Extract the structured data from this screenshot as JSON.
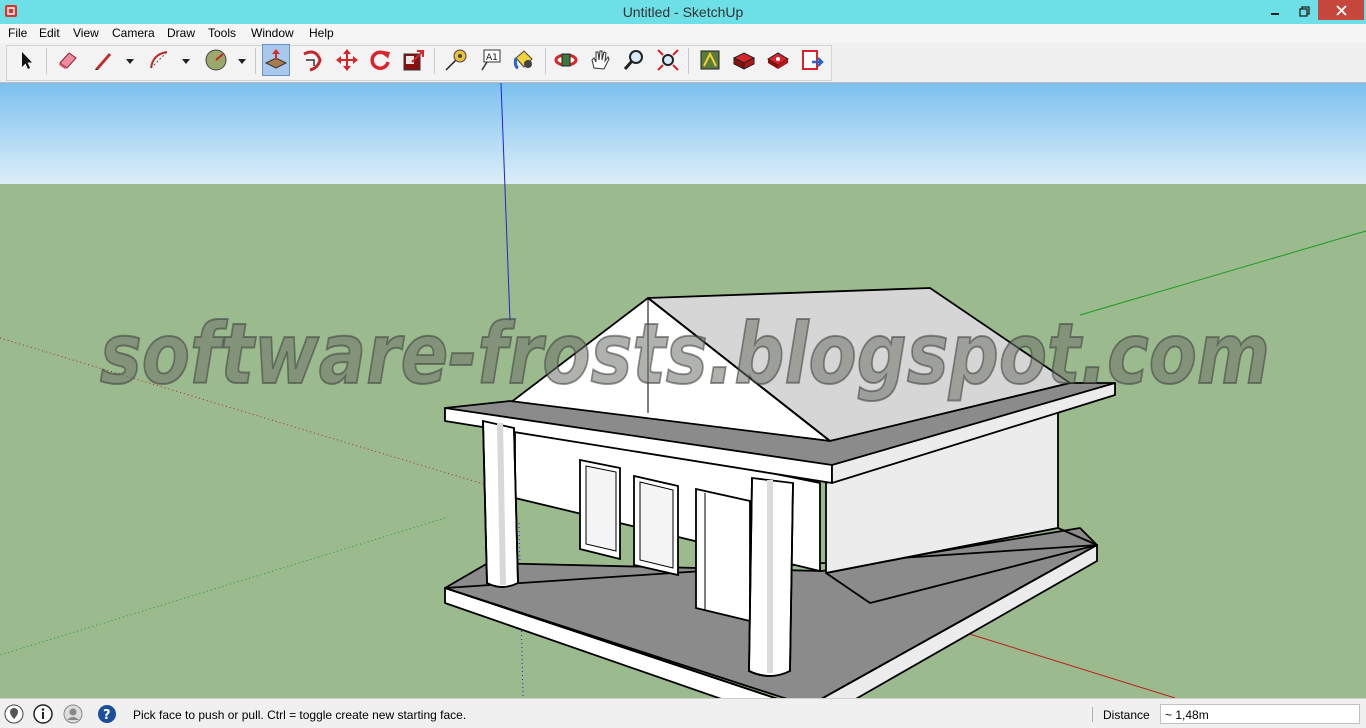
{
  "window": {
    "title": "Untitled - SketchUp"
  },
  "menu": [
    "File",
    "Edit",
    "View",
    "Camera",
    "Draw",
    "Tools",
    "Window",
    "Help"
  ],
  "toolbar": {
    "tools": [
      {
        "name": "select-tool-icon"
      },
      {
        "name": "eraser-tool-icon"
      },
      {
        "name": "line-tool-icon"
      },
      {
        "name": "arc-tool-icon"
      },
      {
        "name": "circle-tool-icon"
      },
      {
        "name": "push-pull-tool-icon",
        "active": true
      },
      {
        "name": "follow-me-tool-icon"
      },
      {
        "name": "move-tool-icon"
      },
      {
        "name": "rotate-tool-icon"
      },
      {
        "name": "scale-tool-icon"
      },
      {
        "name": "tape-measure-tool-icon"
      },
      {
        "name": "text-tool-icon"
      },
      {
        "name": "paint-bucket-tool-icon"
      },
      {
        "name": "orbit-tool-icon"
      },
      {
        "name": "pan-tool-icon"
      },
      {
        "name": "zoom-tool-icon"
      },
      {
        "name": "zoom-extents-tool-icon"
      },
      {
        "name": "3d-warehouse-icon"
      },
      {
        "name": "extension-warehouse-icon"
      },
      {
        "name": "components-icon"
      },
      {
        "name": "send-to-layout-icon"
      }
    ]
  },
  "viewport": {
    "watermark": "software-frosts.blogspot.com",
    "colors": {
      "sky": "#a8d4f2",
      "ground": "#9bbb8f",
      "face": "#ffffff",
      "shade": "#e8e8e8",
      "roof": "#d5d5d5",
      "floor": "#8a8a8a"
    }
  },
  "status": {
    "message": "Pick face to push or pull.  Ctrl = toggle create new starting face.",
    "measure_label": "Distance",
    "measure_value": "~ 1,48m"
  }
}
